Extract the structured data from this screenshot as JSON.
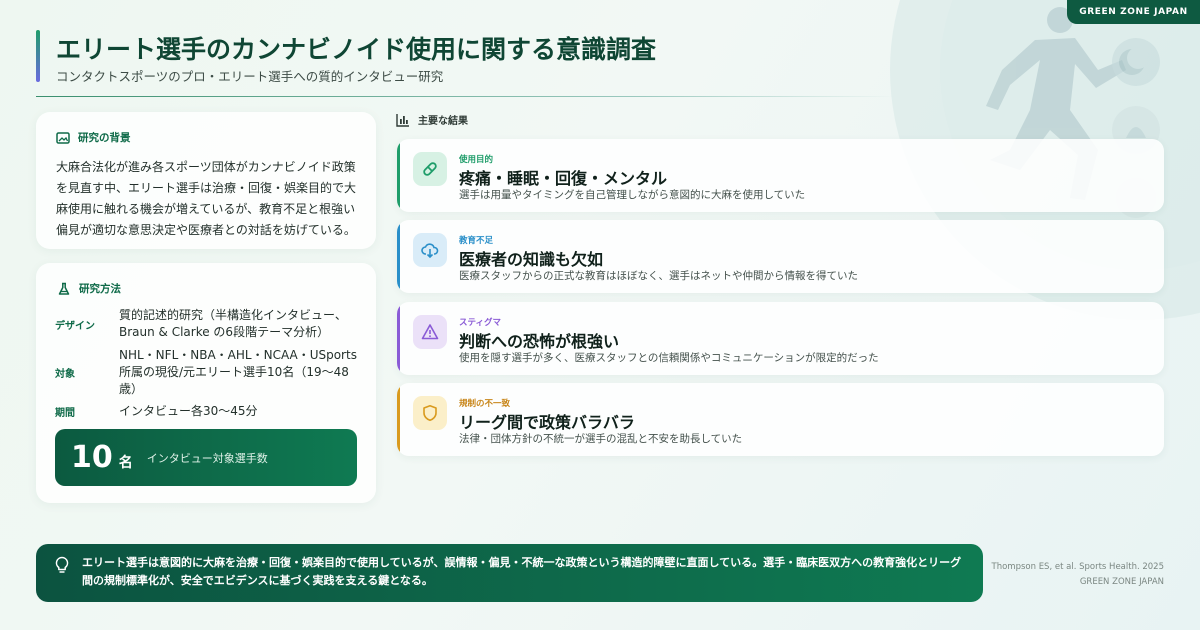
{
  "brand": {
    "tag": "GREEN ZONE JAPAN"
  },
  "header": {
    "title": "エリート選手のカンナビノイド使用に関する意識調査",
    "subtitle": "コンタクトスポーツのプロ・エリート選手への質的インタビュー研究"
  },
  "background": {
    "title": "研究の背景",
    "icon": "image-icon",
    "body": "大麻合法化が進み各スポーツ団体がカンナビノイド政策を見直す中、エリート選手は治療・回復・娯楽目的で大麻使用に触れる機会が増えているが、教育不足と根強い偏見が適切な意思決定や医療者との対話を妨げている。"
  },
  "method": {
    "title": "研究方法",
    "icon": "flask-icon",
    "rows": [
      {
        "key": "デザイン",
        "value": "質的記述的研究（半構造化インタビュー、Braun & Clarke の6段階テーマ分析）"
      },
      {
        "key": "対象",
        "value": "NHL・NFL・NBA・AHL・NCAA・USports所属の現役/元エリート選手10名（19〜48歳）"
      },
      {
        "key": "期間",
        "value": "インタビュー各30〜45分"
      }
    ],
    "count": {
      "number": "10",
      "unit": "名",
      "label": "インタビュー対象選手数"
    }
  },
  "results": {
    "title": "主要な結果",
    "icon": "bar-chart-icon",
    "items": [
      {
        "tag": "使用目的",
        "heading": "疼痛・睡眠・回復・メンタル",
        "desc": "選手は用量やタイミングを自己管理しながら意図的に大麻を使用していた",
        "icon": "pill-icon",
        "color": "#1f9d6a",
        "bg": "#d7f1e4"
      },
      {
        "tag": "教育不足",
        "heading": "医療者の知識も欠如",
        "desc": "医療スタッフからの正式な教育はほぼなく、選手はネットや仲間から情報を得ていた",
        "icon": "cloud-download-icon",
        "color": "#2a8fc9",
        "bg": "#d9ecf8"
      },
      {
        "tag": "スティグマ",
        "heading": "判断への恐怖が根強い",
        "desc": "使用を隠す選手が多く、医療スタッフとの信頼関係やコミュニケーションが限定的だった",
        "icon": "warning-icon",
        "color": "#8a5bd6",
        "bg": "#ebe1f8"
      },
      {
        "tag": "規制の不一致",
        "heading": "リーグ間で政策バラバラ",
        "desc": "法律・団体方針の不統一が選手の混乱と不安を助長していた",
        "icon": "shield-icon",
        "color": "#d99a1e",
        "bg": "#fbefc9"
      }
    ]
  },
  "conclusion": {
    "icon": "lightbulb-icon",
    "text": "エリート選手は意図的に大麻を治療・回復・娯楽目的で使用しているが、誤情報・偏見・不統一な政策という構造的障壁に直面している。選手・臨床医双方への教育強化とリーグ間の規制標準化が、安全でエビデンスに基づく実践を支える鍵となる。"
  },
  "citation": {
    "source": "Thompson ES, et al. Sports Health. 2025",
    "brand": "GREEN ZONE JAPAN"
  }
}
